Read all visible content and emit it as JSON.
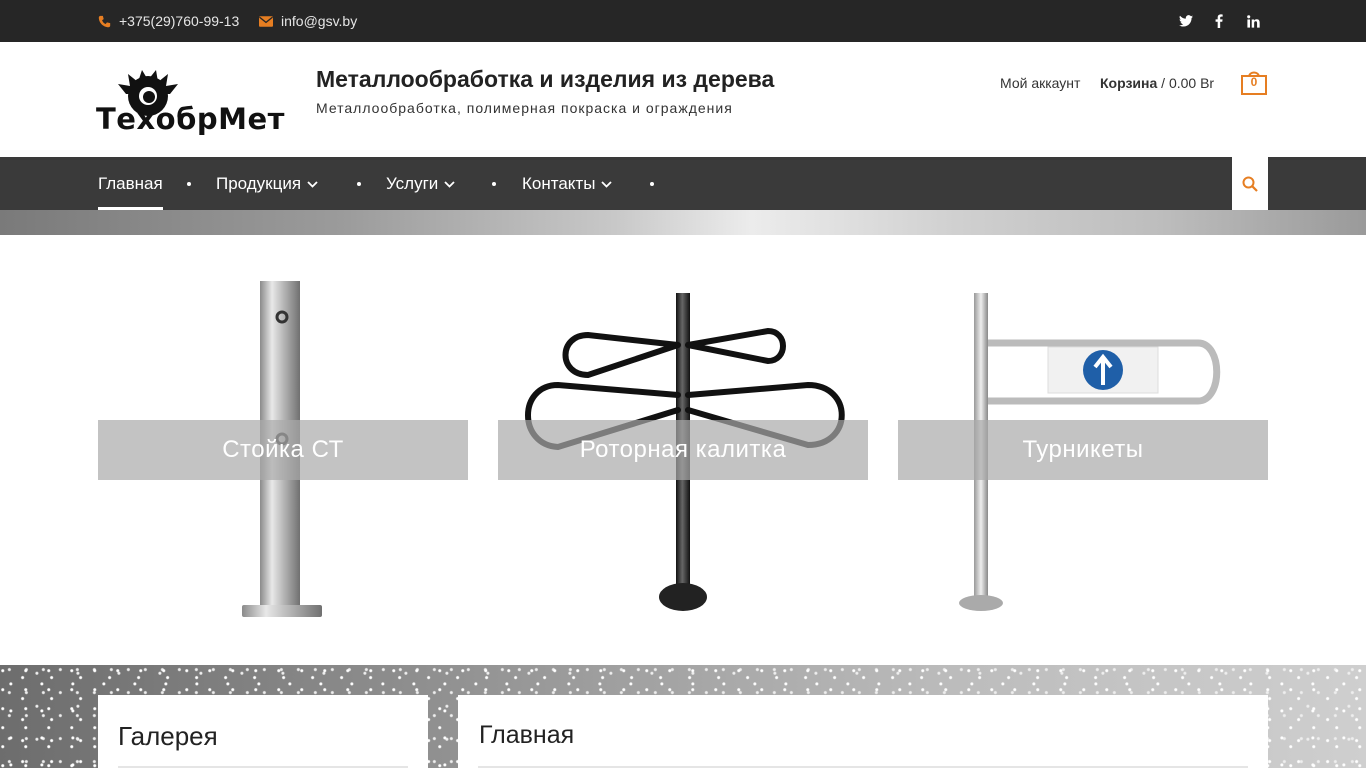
{
  "topbar": {
    "phone": "+375(29)760-99-13",
    "email": "info@gsv.by",
    "social": {
      "twitter_icon": "twitter-icon",
      "facebook_icon": "facebook-icon",
      "linkedin_icon": "linkedin-icon"
    },
    "icon_color": "#e67e22"
  },
  "header": {
    "logo_text": "ТехобрМет",
    "site_title": "Металлообработка и изделия из дерева",
    "site_description": "Металлообработка, полимерная покраска и ограждения",
    "account_label": "Мой аккаунт",
    "cart_label": "Корзина",
    "cart_total": "/ 0.00 Br",
    "cart_count": "0"
  },
  "nav": {
    "items": [
      {
        "label": "Главная",
        "active": true
      },
      {
        "label": "Продукция",
        "dropdown": true
      },
      {
        "label": "Услуги",
        "dropdown": true
      },
      {
        "label": "Контакты",
        "dropdown": true
      }
    ],
    "search_icon": "search-icon"
  },
  "features": [
    {
      "label": "Стойка СТ"
    },
    {
      "label": "Роторная калитка"
    },
    {
      "label": "Турникеты"
    }
  ],
  "widgets": {
    "gallery_title": "Галерея",
    "main_title": "Главная"
  },
  "colors": {
    "accent": "#e67e22",
    "topbar_bg": "#262626",
    "nav_bg": "#3a3a3a"
  }
}
